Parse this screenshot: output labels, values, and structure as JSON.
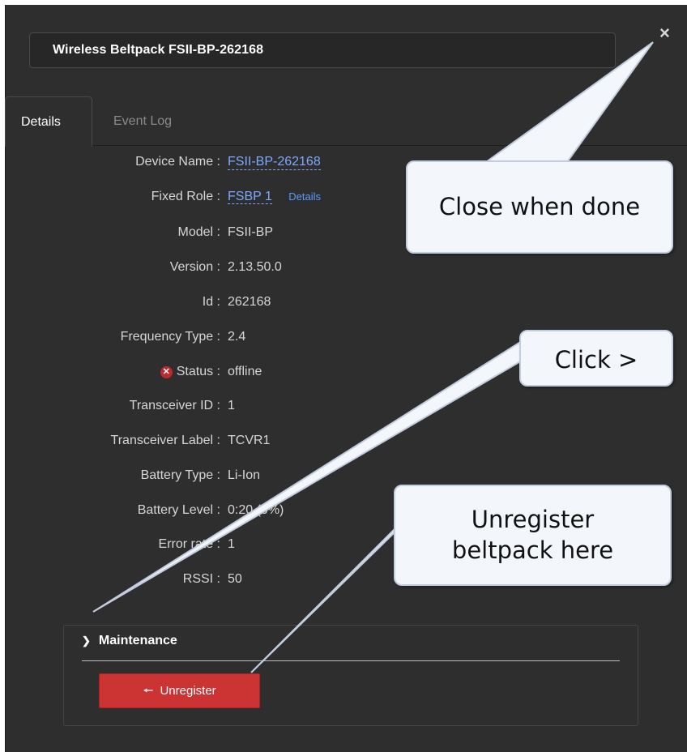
{
  "dialog": {
    "title": "Wireless Beltpack FSII-BP-262168",
    "close_icon": "×"
  },
  "tabs": [
    {
      "label": "Details",
      "active": true
    },
    {
      "label": "Event Log",
      "active": false
    }
  ],
  "details": {
    "device_name": {
      "label": "Device Name :",
      "value": "FSII-BP-262168"
    },
    "fixed_role": {
      "label": "Fixed Role :",
      "value": "FSBP 1",
      "link": "Details"
    },
    "model": {
      "label": "Model :",
      "value": "FSII-BP"
    },
    "version": {
      "label": "Version :",
      "value": "2.13.50.0"
    },
    "id": {
      "label": "Id :",
      "value": "262168"
    },
    "frequency_type": {
      "label": "Frequency Type :",
      "value": "2.4"
    },
    "status": {
      "label": "Status :",
      "value": "offline",
      "icon": "error-circle-icon"
    },
    "transceiver_id": {
      "label": "Transceiver ID :",
      "value": "1"
    },
    "transceiver_label": {
      "label": "Transceiver Label :",
      "value": "TCVR1"
    },
    "battery_type": {
      "label": "Battery Type :",
      "value": "Li-Ion"
    },
    "battery_level": {
      "label": "Battery Level :",
      "value": "0:20 (0%)"
    },
    "error_rate": {
      "label": "Error rate :",
      "value": "1"
    },
    "rssi": {
      "label": "RSSI :",
      "value": "50"
    }
  },
  "maintenance": {
    "title": "Maintenance",
    "unregister_label": "Unregister"
  },
  "callouts": {
    "close": "Close when done",
    "click": "Click >",
    "unregister_line1": "Unregister",
    "unregister_line2": "beltpack here"
  },
  "colors": {
    "panel_bg": "#2e2e2e",
    "link": "#7fa8ff",
    "unregister_button": "#cc3333",
    "status_error": "#c0282f"
  }
}
